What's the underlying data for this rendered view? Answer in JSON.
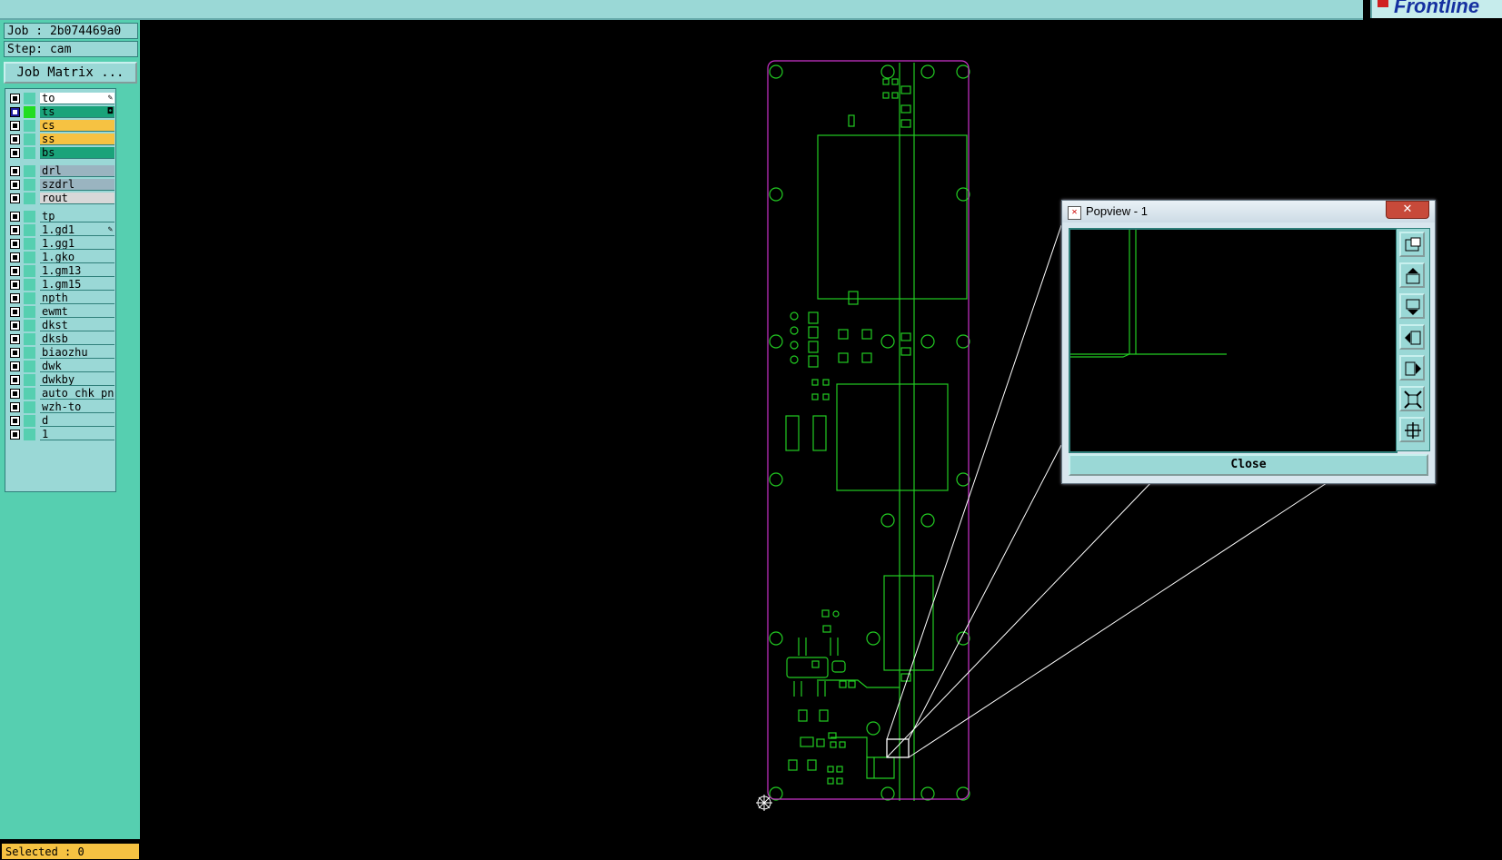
{
  "job_info": {
    "job": "Job : 2b074469a0",
    "step": "Step: cam"
  },
  "job_matrix_label": "Job Matrix ...",
  "layers": [
    {
      "name": "to",
      "color": "#ffffff",
      "checked": false,
      "swatch": "#56cfb0",
      "mark": "pen-icon"
    },
    {
      "name": "ts",
      "color": "#1aa37a",
      "checked": true,
      "swatch": "#22dd22",
      "mark": "lock-icon"
    },
    {
      "name": "cs",
      "color": "#f6c242",
      "checked": false,
      "swatch": "#56cfb0",
      "mark": ""
    },
    {
      "name": "ss",
      "color": "#f6c242",
      "checked": false,
      "swatch": "#56cfb0",
      "mark": ""
    },
    {
      "name": "bs",
      "color": "#1aa37a",
      "checked": false,
      "swatch": "#56cfb0",
      "mark": ""
    },
    {
      "name": "drl",
      "color": "#9ab4c0",
      "checked": false,
      "swatch": "#56cfb0",
      "mark": ""
    },
    {
      "name": "szdrl",
      "color": "#9ab4c0",
      "checked": false,
      "swatch": "#56cfb0",
      "mark": ""
    },
    {
      "name": "rout",
      "color": "#d8d8d8",
      "checked": false,
      "swatch": "#56cfb0",
      "mark": ""
    },
    {
      "name": "tp",
      "color": "#9ad8d6",
      "checked": false,
      "swatch": "#56cfb0",
      "mark": ""
    },
    {
      "name": "1.gd1",
      "color": "#9ad8d6",
      "checked": false,
      "swatch": "#56cfb0",
      "mark": "pen-icon"
    },
    {
      "name": "1.gg1",
      "color": "#9ad8d6",
      "checked": false,
      "swatch": "#56cfb0",
      "mark": ""
    },
    {
      "name": "1.gko",
      "color": "#9ad8d6",
      "checked": false,
      "swatch": "#56cfb0",
      "mark": ""
    },
    {
      "name": "1.gm13",
      "color": "#9ad8d6",
      "checked": false,
      "swatch": "#56cfb0",
      "mark": ""
    },
    {
      "name": "1.gm15",
      "color": "#9ad8d6",
      "checked": false,
      "swatch": "#56cfb0",
      "mark": ""
    },
    {
      "name": "npth",
      "color": "#9ad8d6",
      "checked": false,
      "swatch": "#56cfb0",
      "mark": ""
    },
    {
      "name": "ewmt",
      "color": "#9ad8d6",
      "checked": false,
      "swatch": "#56cfb0",
      "mark": ""
    },
    {
      "name": "dkst",
      "color": "#9ad8d6",
      "checked": false,
      "swatch": "#56cfb0",
      "mark": ""
    },
    {
      "name": "dksb",
      "color": "#9ad8d6",
      "checked": false,
      "swatch": "#56cfb0",
      "mark": ""
    },
    {
      "name": "biaozhu",
      "color": "#9ad8d6",
      "checked": false,
      "swatch": "#56cfb0",
      "mark": ""
    },
    {
      "name": "dwk",
      "color": "#9ad8d6",
      "checked": false,
      "swatch": "#56cfb0",
      "mark": ""
    },
    {
      "name": "dwkby",
      "color": "#9ad8d6",
      "checked": false,
      "swatch": "#56cfb0",
      "mark": ""
    },
    {
      "name": "auto_chk_pn",
      "color": "#9ad8d6",
      "checked": false,
      "swatch": "#56cfb0",
      "mark": ""
    },
    {
      "name": "wzh-to",
      "color": "#9ad8d6",
      "checked": false,
      "swatch": "#56cfb0",
      "mark": ""
    },
    {
      "name": "d",
      "color": "#9ad8d6",
      "checked": false,
      "swatch": "#56cfb0",
      "mark": ""
    },
    {
      "name": "1",
      "color": "#9ad8d6",
      "checked": false,
      "swatch": "#56cfb0",
      "mark": ""
    }
  ],
  "status": {
    "selected": "Selected : 0"
  },
  "popview": {
    "title": "Popview - 1",
    "close_label": "Close",
    "tools": [
      "zoom-fit-icon",
      "pan-up-icon",
      "pan-down-icon",
      "pan-left-icon",
      "pan-right-icon",
      "zoom-in-icon",
      "zoom-out-icon"
    ]
  },
  "logo_text": "Frontline",
  "colors": {
    "board_outline": "#cc33cc",
    "traces": "#22cc22",
    "panel": "#56cfb0",
    "panel_light": "#9ad8d6"
  }
}
